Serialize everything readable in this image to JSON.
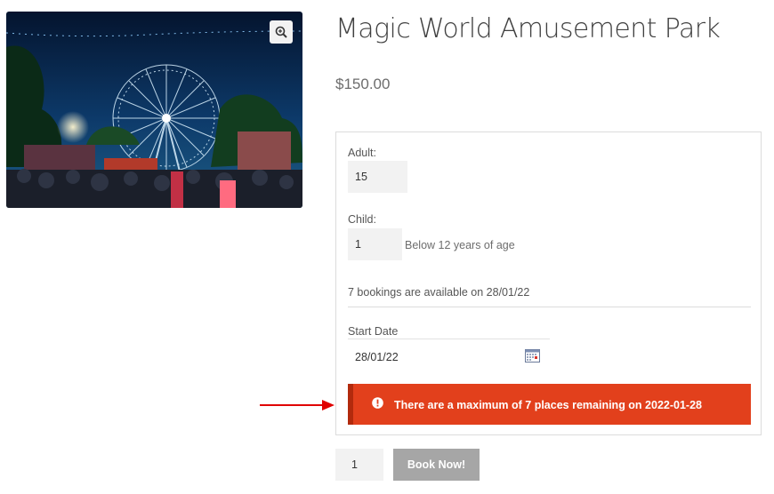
{
  "product": {
    "title": "Magic World Amusement Park",
    "price": "$150.00",
    "image_icon": "ferris-wheel-photo",
    "zoom_icon": "zoom-in-icon"
  },
  "booking": {
    "adult_label": "Adult:",
    "adult_value": "15",
    "child_label": "Child:",
    "child_value": "1",
    "child_hint": "Below 12 years of age",
    "availability": "7 bookings are available on 28/01/22",
    "start_date_label": "Start Date",
    "start_date_value": "28/01/22",
    "calendar_icon": "calendar-icon"
  },
  "error": {
    "message": "There are a maximum of 7 places remaining on 2022-01-28",
    "icon": "exclamation-circle-icon",
    "color": "#e2401c"
  },
  "cart": {
    "quantity": "1",
    "button_label": "Book Now!"
  },
  "annotation": {
    "arrow_color": "#e00000"
  }
}
